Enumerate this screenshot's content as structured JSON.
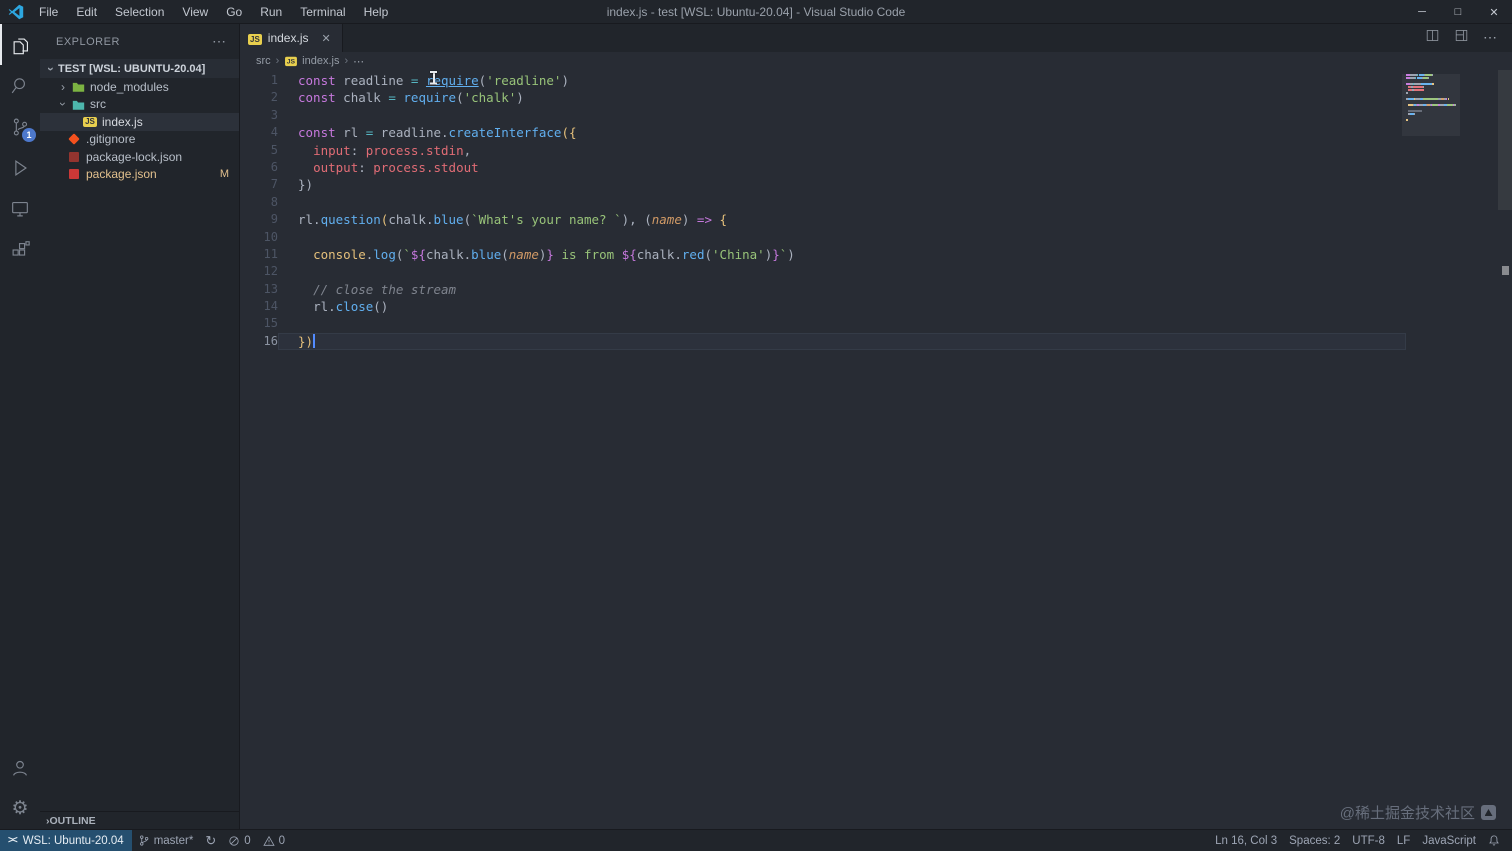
{
  "titlebar": {
    "menus": [
      "File",
      "Edit",
      "Selection",
      "View",
      "Go",
      "Run",
      "Terminal",
      "Help"
    ],
    "title": "index.js - test [WSL: Ubuntu-20.04] - Visual Studio Code",
    "window_controls": {
      "minimize": "─",
      "maximize": "□",
      "close": "✕"
    }
  },
  "activitybar": {
    "items": [
      {
        "id": "explorer",
        "active": true
      },
      {
        "id": "search"
      },
      {
        "id": "source-control",
        "badge": "1"
      },
      {
        "id": "run-debug"
      },
      {
        "id": "remote-explorer"
      },
      {
        "id": "extensions"
      }
    ],
    "bottom_items": [
      {
        "id": "accounts"
      },
      {
        "id": "settings"
      }
    ]
  },
  "sidebar": {
    "title": "EXPLORER",
    "more_label": "⋯",
    "section": "TEST [WSL: UBUNTU-20.04]",
    "files": [
      {
        "label": "node_modules",
        "icon": "folder-green",
        "chevron": "collapsed",
        "level": 1
      },
      {
        "label": "src",
        "icon": "folder-teal",
        "chevron": "expanded",
        "level": 1
      },
      {
        "label": "index.js",
        "icon": "js",
        "level": 2,
        "selected": true
      },
      {
        "label": ".gitignore",
        "icon": "git",
        "level": 1
      },
      {
        "label": "package-lock.json",
        "icon": "npm-lock",
        "level": 1
      },
      {
        "label": "package.json",
        "icon": "npm",
        "level": 1,
        "badge": "M",
        "modified": true
      }
    ],
    "outline": "OUTLINE"
  },
  "editor": {
    "tabs": [
      {
        "label": "index.js",
        "icon": "js",
        "active": true,
        "close": "✕"
      }
    ],
    "actions": [
      "split-editor",
      "toggle-layout",
      "more-actions"
    ],
    "breadcrumbs": [
      {
        "label": "src"
      },
      {
        "label": "index.js",
        "icon": "js"
      },
      {
        "label": "⋯"
      }
    ],
    "active_line": 16,
    "cursor": {
      "line": 16,
      "col": 3
    },
    "lines": [
      {
        "n": 1,
        "t": [
          [
            "kw",
            "const"
          ],
          [
            "pl",
            " readline "
          ],
          [
            "op",
            "="
          ],
          [
            "pl",
            " "
          ],
          [
            "fnu",
            "require"
          ],
          [
            "pl",
            "("
          ],
          [
            "st",
            "'readline'"
          ],
          [
            "pl",
            ")"
          ]
        ]
      },
      {
        "n": 2,
        "t": [
          [
            "kw",
            "const"
          ],
          [
            "pl",
            " chalk "
          ],
          [
            "op",
            "="
          ],
          [
            "pl",
            " "
          ],
          [
            "fn",
            "require"
          ],
          [
            "pl",
            "("
          ],
          [
            "st",
            "'chalk'"
          ],
          [
            "pl",
            ")"
          ]
        ]
      },
      {
        "n": 3,
        "t": []
      },
      {
        "n": 4,
        "t": [
          [
            "kw",
            "const"
          ],
          [
            "pl",
            " rl "
          ],
          [
            "op",
            "="
          ],
          [
            "pl",
            " readline."
          ],
          [
            "fn",
            "createInterface"
          ],
          [
            "br",
            "({"
          ]
        ]
      },
      {
        "n": 5,
        "t": [
          [
            "ws",
            "  "
          ],
          [
            "rd",
            "input"
          ],
          [
            "pl",
            ": "
          ],
          [
            "rd",
            "process.stdin"
          ],
          [
            "pl",
            ","
          ]
        ]
      },
      {
        "n": 6,
        "t": [
          [
            "ws",
            "  "
          ],
          [
            "rd",
            "output"
          ],
          [
            "pl",
            ": "
          ],
          [
            "rd",
            "process.stdout"
          ]
        ]
      },
      {
        "n": 7,
        "t": [
          [
            "pl",
            "})"
          ]
        ]
      },
      {
        "n": 8,
        "t": []
      },
      {
        "n": 9,
        "t": [
          [
            "pl",
            "rl."
          ],
          [
            "fn",
            "question"
          ],
          [
            "br",
            "("
          ],
          [
            "pl",
            "chalk."
          ],
          [
            "fn",
            "blue"
          ],
          [
            "pl",
            "("
          ],
          [
            "st",
            "`What's your name? `"
          ],
          [
            "pl",
            "), ("
          ],
          [
            "pm",
            "name"
          ],
          [
            "pl",
            ") "
          ],
          [
            "ar",
            "=>"
          ],
          [
            "pl",
            " "
          ],
          [
            "br",
            "{"
          ]
        ]
      },
      {
        "n": 10,
        "t": []
      },
      {
        "n": 11,
        "t": [
          [
            "ws",
            "  "
          ],
          [
            "ob",
            "console"
          ],
          [
            "pl",
            "."
          ],
          [
            "fn",
            "log"
          ],
          [
            "pl",
            "("
          ],
          [
            "st",
            "`"
          ],
          [
            "ip",
            "${"
          ],
          [
            "pl",
            "chalk."
          ],
          [
            "fn",
            "blue"
          ],
          [
            "pl",
            "("
          ],
          [
            "pm",
            "name"
          ],
          [
            "pl",
            ")"
          ],
          [
            "ip",
            "}"
          ],
          [
            "st",
            " is from "
          ],
          [
            "ip",
            "${"
          ],
          [
            "pl",
            "chalk."
          ],
          [
            "fn",
            "red"
          ],
          [
            "pl",
            "("
          ],
          [
            "st",
            "'China'"
          ],
          [
            "pl",
            ")"
          ],
          [
            "ip",
            "}"
          ],
          [
            "st",
            "`"
          ],
          [
            "pl",
            ")"
          ]
        ]
      },
      {
        "n": 12,
        "t": []
      },
      {
        "n": 13,
        "t": [
          [
            "ws",
            "  "
          ],
          [
            "cm",
            "// close the stream"
          ]
        ]
      },
      {
        "n": 14,
        "t": [
          [
            "ws",
            "  "
          ],
          [
            "pl",
            "rl."
          ],
          [
            "fn",
            "close"
          ],
          [
            "pl",
            "()"
          ]
        ]
      },
      {
        "n": 15,
        "t": []
      },
      {
        "n": 16,
        "t": [
          [
            "br",
            "})"
          ]
        ]
      }
    ]
  },
  "statusbar": {
    "remote": {
      "label": "WSL: Ubuntu-20.04"
    },
    "left": [
      {
        "icon": "branch",
        "label": "master*"
      },
      {
        "icon": "sync",
        "label": ""
      },
      {
        "icon": "error",
        "label": "0"
      },
      {
        "icon": "warning",
        "label": "0"
      }
    ],
    "right": [
      {
        "label": "Ln 16, Col 3"
      },
      {
        "label": "Spaces: 2"
      },
      {
        "label": "UTF-8"
      },
      {
        "label": "LF"
      },
      {
        "label": "JavaScript"
      },
      {
        "icon": "bell",
        "label": ""
      }
    ]
  },
  "watermark": "@稀土掘金技术社区",
  "colors": {
    "editor_bg": "#282c34",
    "chrome_bg": "#21252b",
    "keyword_purple": "#c678dd",
    "function_blue": "#61afef",
    "string_green": "#98c379",
    "property_red": "#e06c75",
    "param_orange": "#d19a66",
    "bracket_gold": "#e5c07b",
    "operator_cyan": "#56b6c2",
    "comment_gray": "#7f848e",
    "remote_bg": "#254f6f",
    "badge_blue": "#4d78cc",
    "git_modified": "#e2c08d",
    "cursor_blue": "#528bff"
  }
}
